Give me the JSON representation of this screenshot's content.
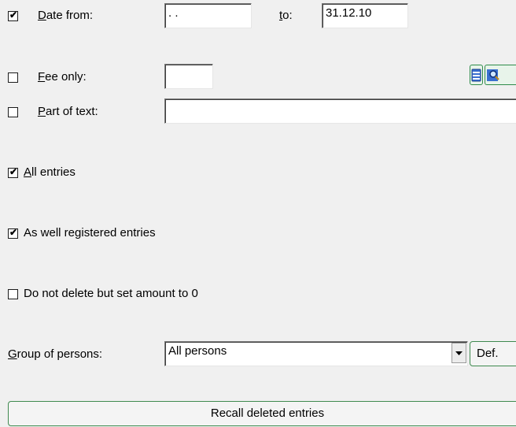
{
  "date_filter": {
    "checked": true,
    "label_prefix": "",
    "label_underline": "D",
    "label_rest": "ate from:",
    "from_value": " . .",
    "to_underline": "t",
    "to_rest": "o:",
    "to_value": "31.12.10"
  },
  "fee_only": {
    "checked": false,
    "label_underline": "F",
    "label_rest": "ee only:",
    "value": ""
  },
  "part_of_text": {
    "checked": false,
    "label_underline": "P",
    "label_rest": "art of text:",
    "value": ""
  },
  "all_entries": {
    "checked": true,
    "label_underline": "A",
    "label_rest": "ll entries"
  },
  "registered_entries": {
    "checked": true,
    "label": "As well registered entries"
  },
  "no_delete": {
    "checked": false,
    "label": "Do not delete but set amount to 0"
  },
  "group_of_persons": {
    "label_underline": "G",
    "label_rest": "roup of persons:",
    "selected": "All persons",
    "def_button": "Def."
  },
  "recall_button": {
    "label": "Recall deleted entries"
  },
  "icons": [
    "list-icon",
    "search-icon"
  ],
  "colors": {
    "accent_border": "#3f8a4f",
    "background": "#f0f0f0"
  }
}
